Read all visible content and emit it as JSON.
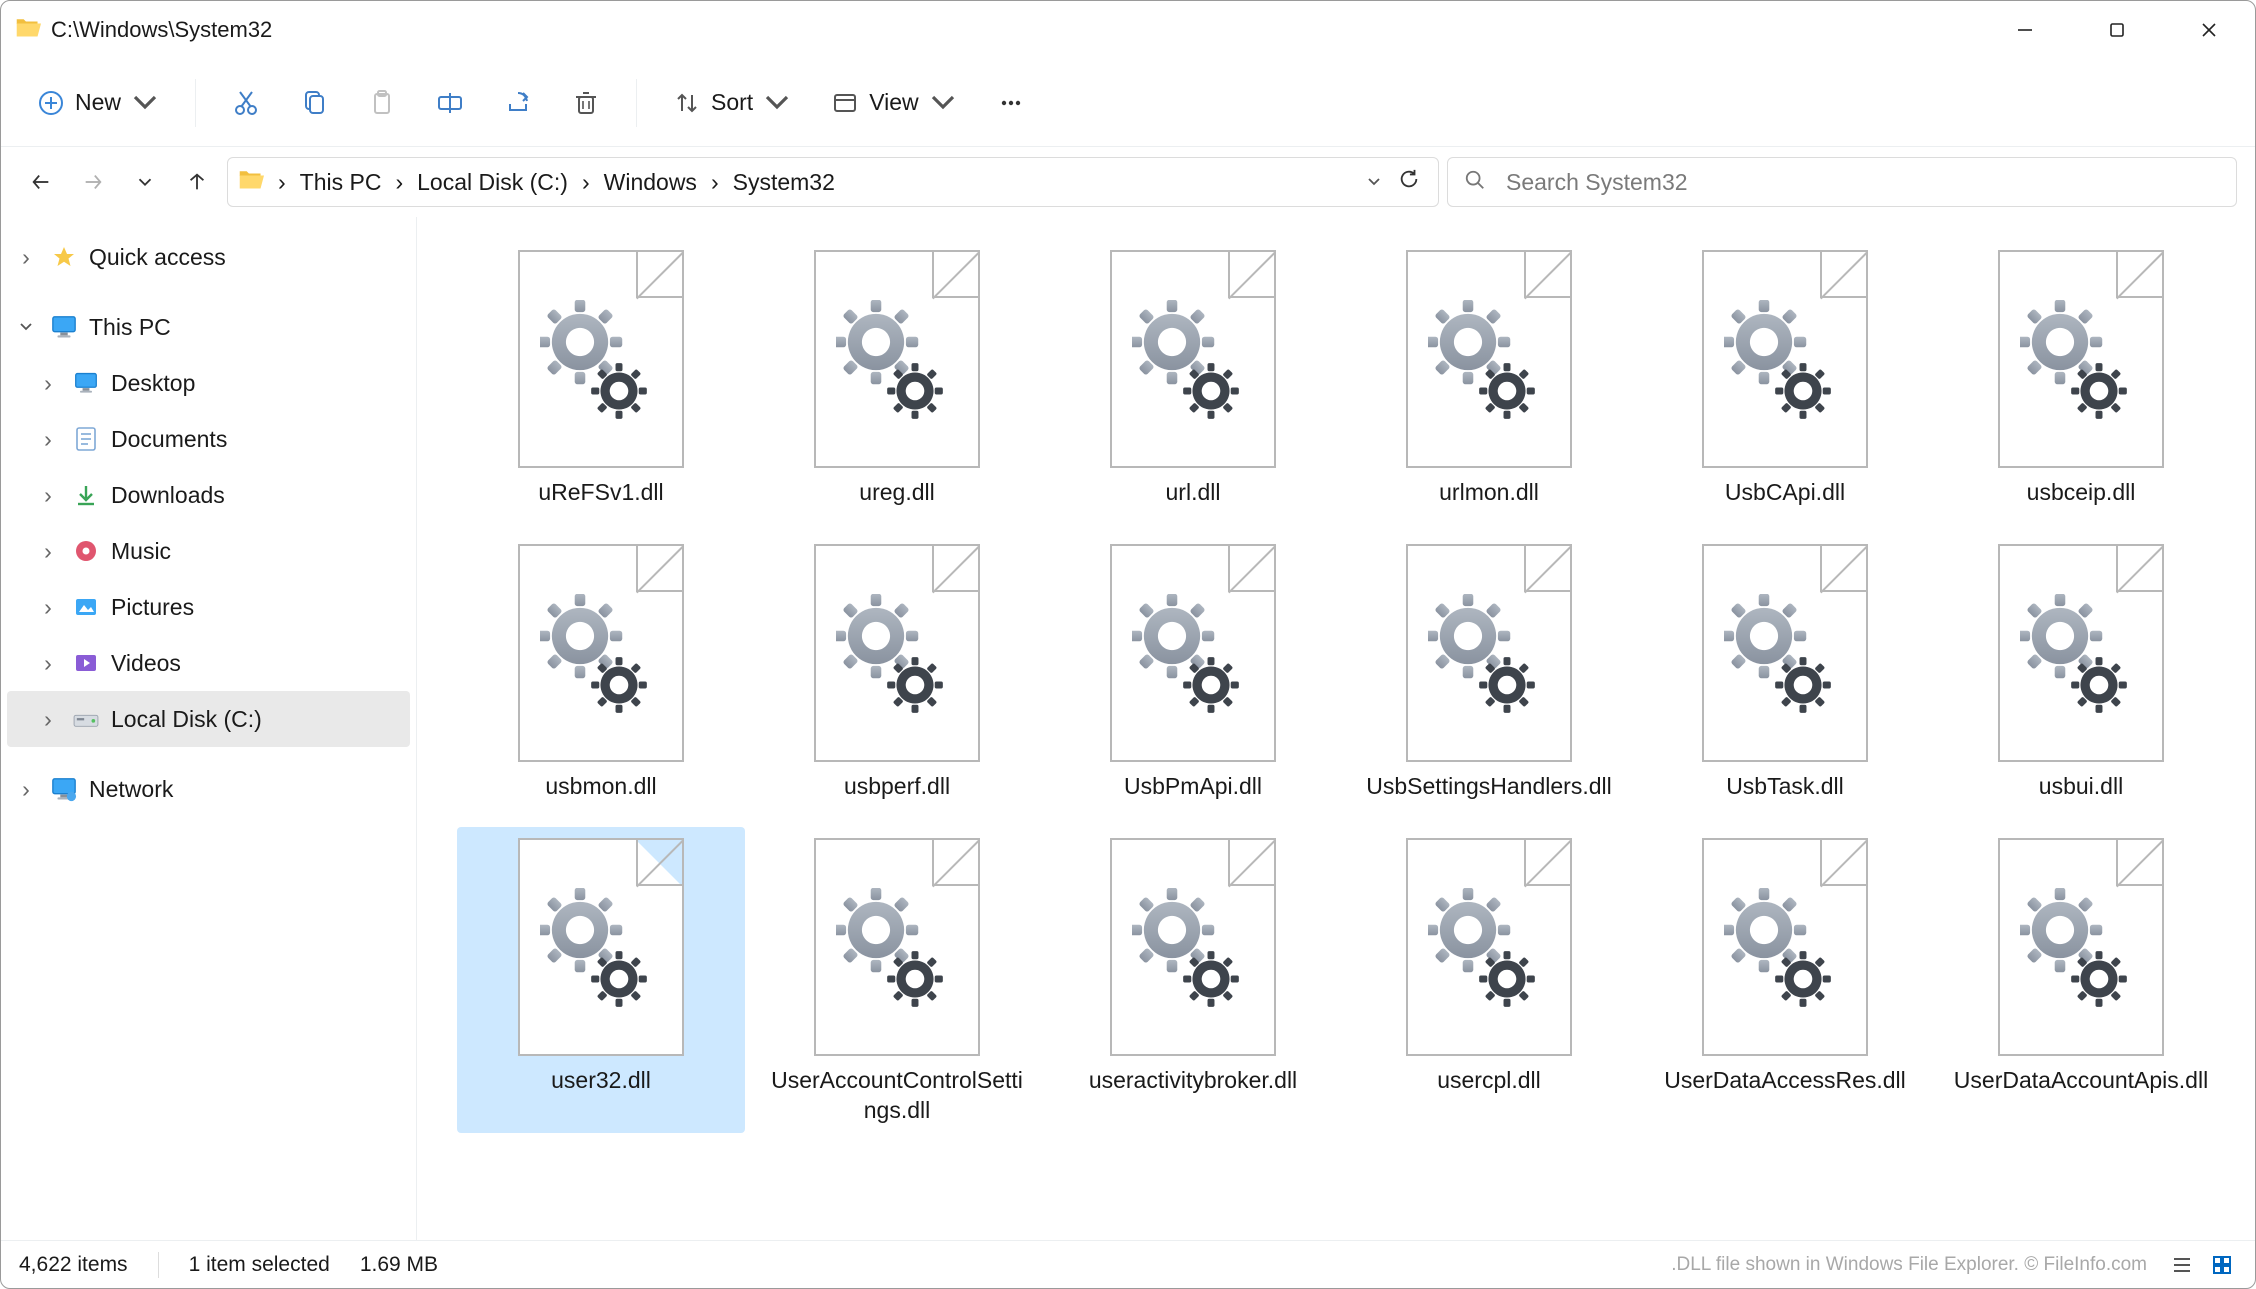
{
  "window": {
    "title": "C:\\Windows\\System32"
  },
  "commandbar": {
    "new_label": "New",
    "sort_label": "Sort",
    "view_label": "View"
  },
  "breadcrumbs": {
    "root": "This PC",
    "a": "Local Disk (C:)",
    "b": "Windows",
    "c": "System32"
  },
  "search": {
    "placeholder": "Search System32"
  },
  "sidebar": {
    "quick_access": "Quick access",
    "this_pc": "This PC",
    "items": [
      {
        "label": "Desktop"
      },
      {
        "label": "Documents"
      },
      {
        "label": "Downloads"
      },
      {
        "label": "Music"
      },
      {
        "label": "Pictures"
      },
      {
        "label": "Videos"
      },
      {
        "label": "Local Disk (C:)"
      }
    ],
    "network": "Network"
  },
  "files": [
    {
      "name": "uReFSv1.dll",
      "selected": false
    },
    {
      "name": "ureg.dll",
      "selected": false
    },
    {
      "name": "url.dll",
      "selected": false
    },
    {
      "name": "urlmon.dll",
      "selected": false
    },
    {
      "name": "UsbCApi.dll",
      "selected": false
    },
    {
      "name": "usbceip.dll",
      "selected": false
    },
    {
      "name": "usbmon.dll",
      "selected": false
    },
    {
      "name": "usbperf.dll",
      "selected": false
    },
    {
      "name": "UsbPmApi.dll",
      "selected": false
    },
    {
      "name": "UsbSettingsHandlers.dll",
      "selected": false
    },
    {
      "name": "UsbTask.dll",
      "selected": false
    },
    {
      "name": "usbui.dll",
      "selected": false
    },
    {
      "name": "user32.dll",
      "selected": true
    },
    {
      "name": "UserAccountControlSettings.dll",
      "selected": false
    },
    {
      "name": "useractivitybroker.dll",
      "selected": false
    },
    {
      "name": "usercpl.dll",
      "selected": false
    },
    {
      "name": "UserDataAccessRes.dll",
      "selected": false
    },
    {
      "name": "UserDataAccountApis.dll",
      "selected": false
    }
  ],
  "statusbar": {
    "item_count": "4,622 items",
    "selection": "1 item selected",
    "size": "1.69 MB",
    "watermark": ".DLL file shown in Windows File Explorer. © FileInfo.com"
  }
}
